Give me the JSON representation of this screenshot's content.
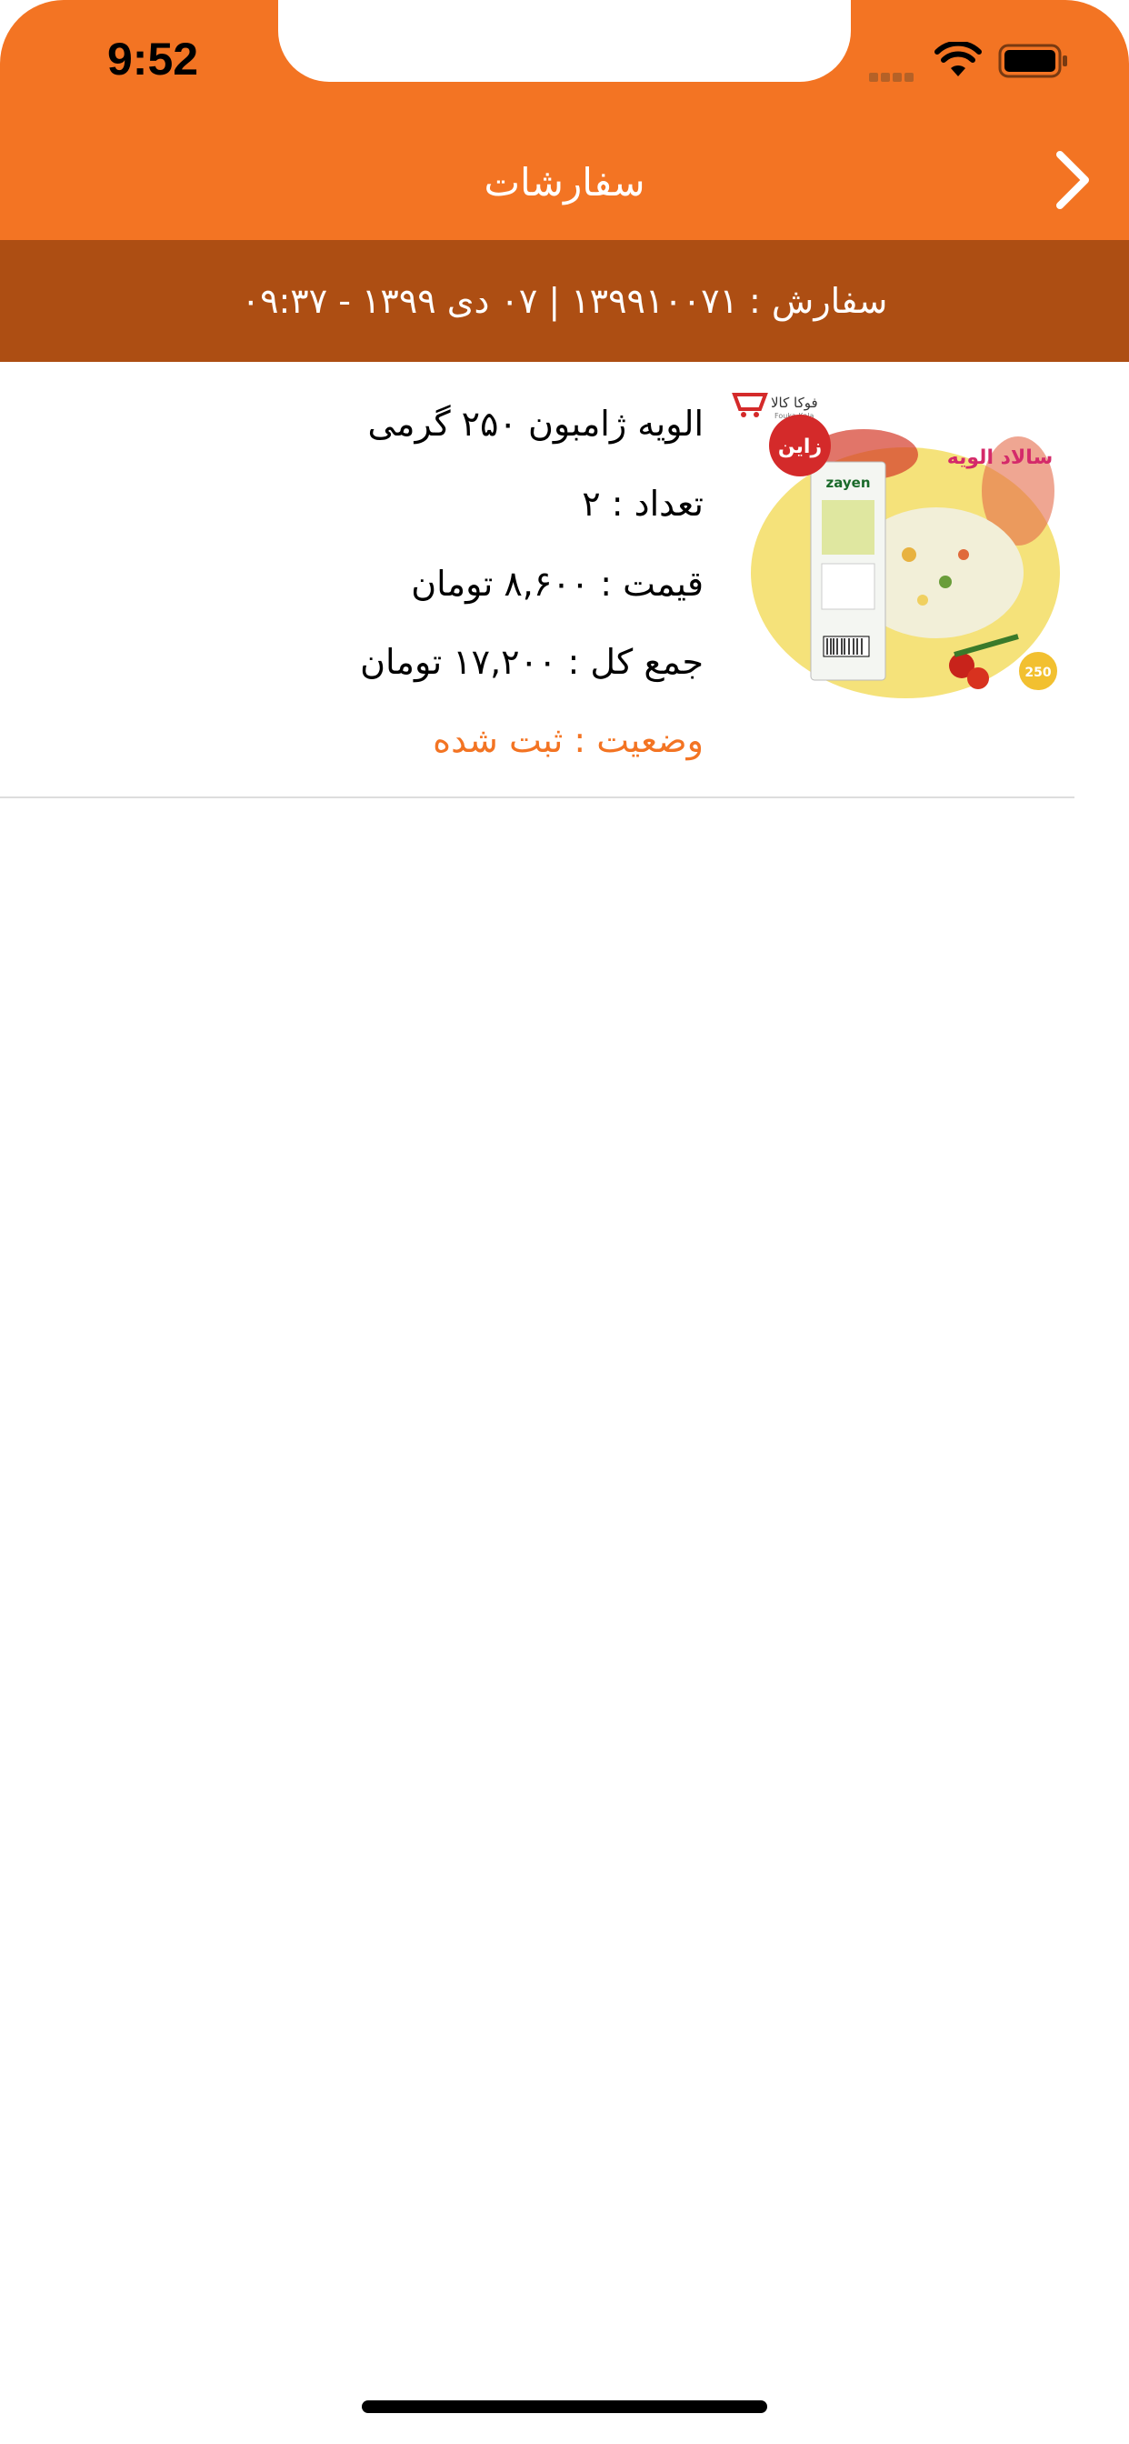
{
  "status_bar": {
    "time": "9:52"
  },
  "nav": {
    "title": "سفارشات"
  },
  "order": {
    "summary": "سفارش :  ۱۳۹۹۱۰۰۷۱ | ۰۷ دی ۱۳۹۹ - ۰۹:۳۷"
  },
  "items": [
    {
      "name": "الویه ژامبون ۲۵۰ گرمی",
      "quantity": "تعداد : ۲",
      "price": "قیمت : ۸,۶۰۰ تومان",
      "total": "جمع کل : ۱۷,۲۰۰ تومان",
      "status": "وضعیت : ثبت شده",
      "image": {
        "store_logo": "فوکا کالا",
        "store_logo_en": "Fouka Kala",
        "brand": "زاین",
        "brand_en": "zayen",
        "package_title": "سالاد الویه",
        "weight": "250"
      }
    }
  ],
  "colors": {
    "primary": "#f37423",
    "secondary": "#ad4e13",
    "status": "#f37423"
  }
}
